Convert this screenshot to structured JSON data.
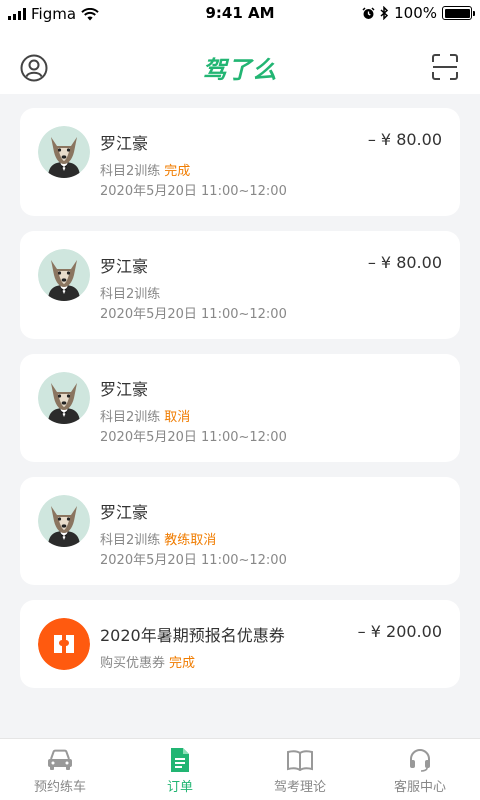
{
  "status_bar": {
    "carrier": "Figma",
    "time": "9:41 AM",
    "battery": "100%"
  },
  "navbar": {
    "logo_text": "驾了么",
    "accent_color": "#22b573"
  },
  "orders": [
    {
      "name": "罗江豪",
      "amount": "– ¥ 80.00",
      "subject": "科目2训练",
      "status": "完成",
      "datetime": "2020年5月20日  11:00~12:00"
    },
    {
      "name": "罗江豪",
      "amount": "– ¥ 80.00",
      "subject": "科目2训练",
      "status": "",
      "datetime": "2020年5月20日  11:00~12:00"
    },
    {
      "name": "罗江豪",
      "amount": "",
      "subject": "科目2训练",
      "status": "取消",
      "datetime": "2020年5月20日  11:00~12:00"
    },
    {
      "name": "罗江豪",
      "amount": "",
      "subject": "科目2训练",
      "status": "教练取消",
      "datetime": "2020年5月20日  11:00~12:00"
    }
  ],
  "coupon": {
    "title": "2020年暑期预报名优惠券",
    "amount": "– ¥ 200.00",
    "subtitle": "购买优惠券",
    "status": "完成"
  },
  "tabbar": {
    "tabs": [
      {
        "label": "预约练车",
        "icon": "car-icon",
        "active": false
      },
      {
        "label": "订单",
        "icon": "document-icon",
        "active": true
      },
      {
        "label": "驾考理论",
        "icon": "book-icon",
        "active": false
      },
      {
        "label": "客服中心",
        "icon": "headset-icon",
        "active": false
      }
    ]
  },
  "colors": {
    "status_orange": "#f07c00",
    "coupon_orange": "#ff5a0f"
  }
}
